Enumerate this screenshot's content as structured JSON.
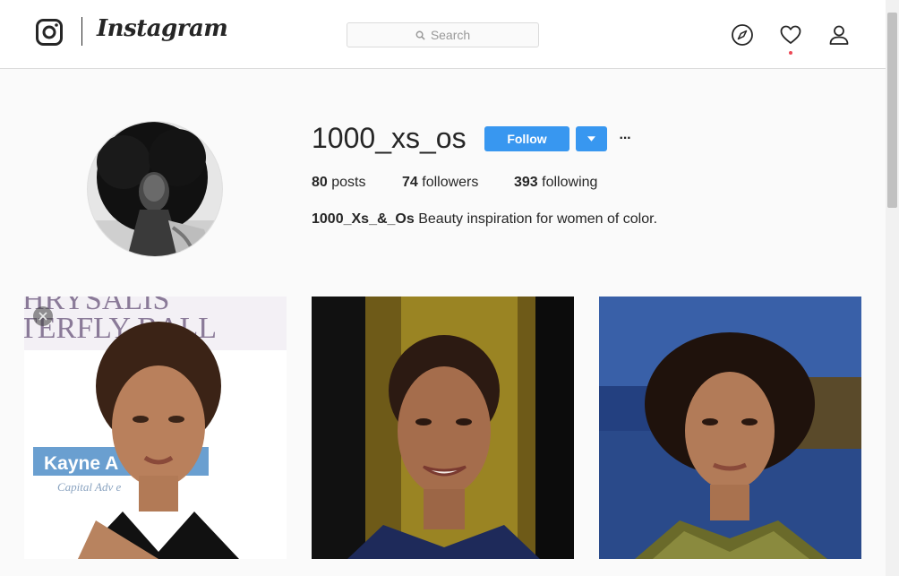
{
  "header": {
    "brand": "Instagram",
    "search_placeholder": "Search",
    "has_notification": true
  },
  "profile": {
    "username": "1000_xs_os",
    "follow_label": "Follow",
    "more_label": "···",
    "posts_count": "80",
    "posts_label": "posts",
    "followers_count": "74",
    "followers_label": "followers",
    "following_count": "393",
    "following_label": "following",
    "full_name": "1000_Xs_&_Os",
    "bio": "Beauty inspiration for women of color."
  },
  "posts": [
    {
      "sign_line_1": "HRYSALIS",
      "sign_line_2": "TERFLY BALL",
      "sign_line_3": "Kayne A",
      "sign_line_4": "Capital Adv       e"
    },
    {},
    {}
  ],
  "colors": {
    "accent": "#3897f0",
    "notification": "#ed4956",
    "text": "#262626",
    "background": "#fafafa"
  },
  "icons": [
    "instagram-glyph-icon",
    "search-icon",
    "explore-compass-icon",
    "heart-icon",
    "profile-icon",
    "caret-down-icon",
    "close-icon"
  ]
}
